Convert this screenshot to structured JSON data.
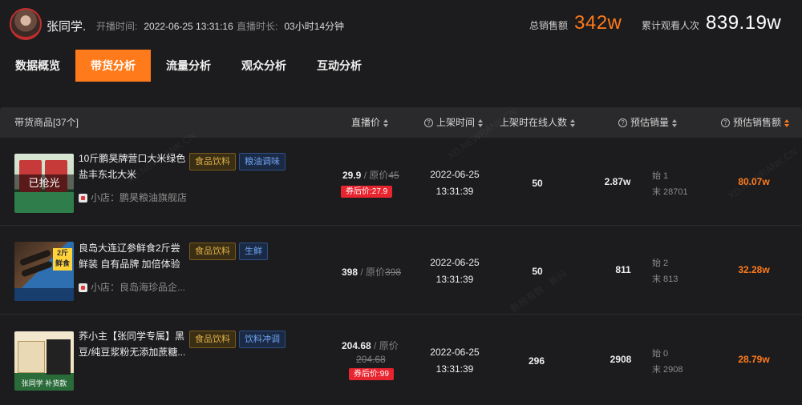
{
  "header": {
    "host_name": "张同学.",
    "start_label": "开播时间:",
    "start_value": "2022-06-25 13:31:16",
    "duration_label": "直播时长:",
    "duration_value": "03小时14分钟",
    "sales_label": "总销售额",
    "sales_value": "342w",
    "views_label": "累计观看人次",
    "views_value": "839.19w",
    "accent": "#ff7a1a"
  },
  "tabs": [
    {
      "label": "数据概览"
    },
    {
      "label": "带货分析"
    },
    {
      "label": "流量分析"
    },
    {
      "label": "观众分析"
    },
    {
      "label": "互动分析"
    }
  ],
  "table": {
    "headers": {
      "product": "带货商品[37个]",
      "price": "直播价",
      "listed_time": "上架时间",
      "online": "上架时在线人数",
      "est_volume": "预估销量",
      "est_sales": "预估销售额"
    },
    "rows": [
      {
        "name": "10斤鹏昊牌营口大米绿色盐丰东北大米",
        "thumb_text": "已抢光",
        "category_tag": "食品饮料",
        "sub_tag": "粮油调味",
        "shop": "小店：鹏昊粮油旗舰店",
        "price": "29.9",
        "orig_label": "/ 原价",
        "orig_price": "45",
        "coupon": "券后价:27.9",
        "date": "2022-06-25",
        "time": "13:31:39",
        "online": "50",
        "volume": "2.87w",
        "start_label": "始 1",
        "end_label": "末 28701",
        "sales": "80.07w"
      },
      {
        "name": "良岛大连辽参鲜食2斤尝鲜装 自有品牌 加倍体验",
        "thumb_text": "2斤 鲜食",
        "category_tag": "食品饮料",
        "sub_tag": "生鲜",
        "shop": "小店：良岛海珍品企...",
        "price": "398",
        "orig_label": "/ 原价",
        "orig_price": "398",
        "coupon": "",
        "date": "2022-06-25",
        "time": "13:31:39",
        "online": "50",
        "volume": "811",
        "start_label": "始 2",
        "end_label": "末 813",
        "sales": "32.28w"
      },
      {
        "name": "荞小主【张同学专属】黑豆/纯豆浆粉无添加蔗糖...",
        "thumb_text": "张同学 补货款",
        "category_tag": "食品饮料",
        "sub_tag": "饮料冲调",
        "shop": "",
        "price": "204.68",
        "orig_label": "/ 原价",
        "orig_price": "204.68",
        "coupon": "券后价:99",
        "date": "2022-06-25",
        "time": "13:31:39",
        "online": "296",
        "volume": "2908",
        "start_label": "始 0",
        "end_label": "末 2908",
        "sales": "28.79w"
      }
    ]
  },
  "watermarks": [
    "XD.NEWRANK.CN",
    "XD.NEWRANK.CN",
    "新榜有数 · 新抖",
    "XD.NEWRANK.CN"
  ]
}
